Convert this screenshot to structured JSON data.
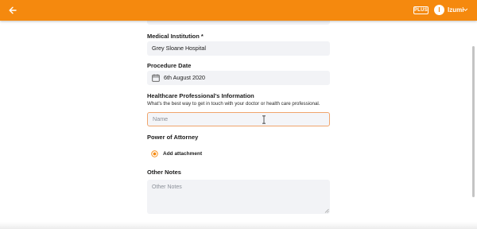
{
  "header": {
    "back_icon": "arrow-left-icon",
    "plan_badge": "PLUS",
    "user_initial": "I",
    "user_name": "Izumi",
    "menu_icon": "chevron-down-icon",
    "accent_color": "#f5890e"
  },
  "form": {
    "medical_institution": {
      "label": "Medical Institution *",
      "value": "Grey Sloane Hospital"
    },
    "procedure_date": {
      "label": "Procedure Date",
      "value": "6th August 2020",
      "icon": "calendar-icon"
    },
    "healthcare_professional": {
      "label": "Healthcare Professional's Information",
      "helper": "What's the best way to get in touch with your doctor or health care professional.",
      "placeholder": "Name"
    },
    "power_of_attorney": {
      "label": "Power of Attorney",
      "attach_label": "Add attachment",
      "attach_icon": "add-circle-icon"
    },
    "other_notes": {
      "label": "Other Notes",
      "placeholder": "Other Notes"
    }
  }
}
